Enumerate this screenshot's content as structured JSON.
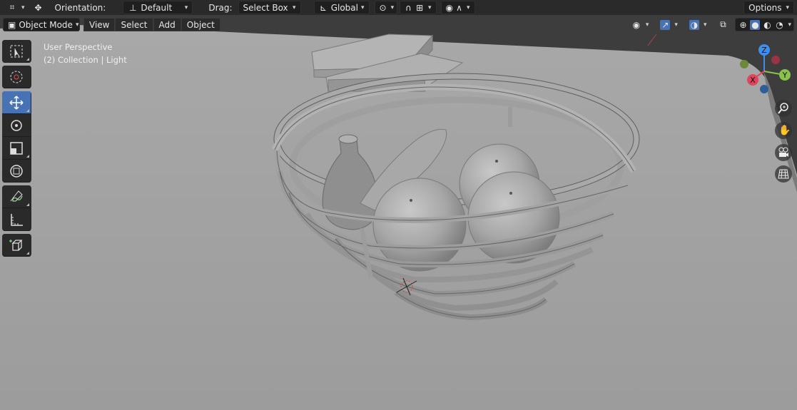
{
  "tool_header": {
    "orientation_label": "Orientation:",
    "orientation_value": "Default",
    "drag_label": "Drag:",
    "drag_value": "Select Box",
    "transform_value": "Global",
    "options_label": "Options"
  },
  "view_header": {
    "mode_value": "Object Mode",
    "menus": [
      "View",
      "Select",
      "Add",
      "Object"
    ]
  },
  "overlay": {
    "perspective": "User Perspective",
    "collection": "(2) Collection | Light"
  },
  "gizmo": {
    "x_label": "X",
    "y_label": "Y",
    "z_label": "Z"
  },
  "colors": {
    "accent": "#4772b3",
    "axis_x": "#e0455d",
    "axis_y": "#8bc34a",
    "axis_z": "#3d8ef0",
    "viewport_bg": "#3d3d3d",
    "table": "#9a9a9a"
  },
  "icons": {
    "toolbar": [
      "select-box-icon",
      "cursor-icon",
      "move-icon",
      "rotate-icon",
      "scale-icon",
      "transform-icon",
      "annotate-icon",
      "measure-icon",
      "add-cube-icon"
    ],
    "nav": [
      "zoom-icon",
      "hand-pan-icon",
      "camera-icon",
      "grid-ortho-icon"
    ]
  }
}
